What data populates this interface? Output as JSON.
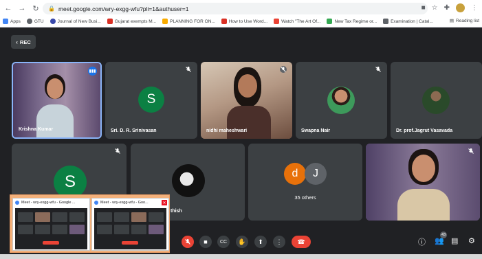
{
  "browser": {
    "url": "meet.google.com/wry-exgg-wfu?pli=1&authuser=1",
    "bookmarks": [
      {
        "label": "Apps",
        "color": "#4285f4"
      },
      {
        "label": "GTU",
        "color": "#5f6368"
      },
      {
        "label": "Journal of New Busi...",
        "color": "#3949ab"
      },
      {
        "label": "Gujarat exempts M...",
        "color": "#d93025"
      },
      {
        "label": "PLANNING FOR ON...",
        "color": "#f9ab00"
      },
      {
        "label": "How to Use Word...",
        "color": "#d93025"
      },
      {
        "label": "Watch \"The Art Of...",
        "color": "#ea4335"
      },
      {
        "label": "New Tax Regime or...",
        "color": "#34a853"
      },
      {
        "label": "Examination | Catal...",
        "color": "#5f6368"
      }
    ],
    "reading_list": "Reading list"
  },
  "meet": {
    "rec_label": "REC",
    "participants": [
      {
        "name": "Krishna Kumar",
        "type": "video"
      },
      {
        "name": "Sri. D. R. Srinivasan",
        "initial": "S",
        "color": "#0b8043"
      },
      {
        "name": "nidhi maheshwari",
        "type": "video"
      },
      {
        "name": "Swapna Nair",
        "type": "photo"
      },
      {
        "name": "Dr. prof.Jagrut Vasavada",
        "type": "photo"
      },
      {
        "initial": "S",
        "color": "#0b8043"
      },
      {
        "name": "thish",
        "type": "photo"
      },
      {
        "others_initials": [
          "d",
          "J"
        ],
        "others_label": "35 others"
      },
      {
        "type": "video"
      }
    ],
    "participant_count": "43"
  },
  "taskbar_preview": [
    {
      "title": "Meet - wry-exgg-wfu - Google ..."
    },
    {
      "title": "Meet - wry-exgg-wfu - Goo..."
    }
  ],
  "colors": {
    "background": "#202124",
    "tile": "#3c4043",
    "mic_off": "#ea4335",
    "accent": "#1a73e8"
  }
}
